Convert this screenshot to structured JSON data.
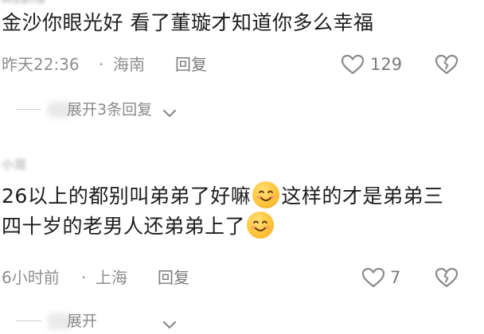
{
  "comments": [
    {
      "text": "金沙你眼光好  看了董璇才知道你多么幸福",
      "time": "昨天22:36",
      "separator": "·",
      "location": "海南",
      "reply_label": "回复",
      "like_count": "129",
      "expand_label": "展开3条回复"
    },
    {
      "text_part1": "26以上的都别叫弟弟了好嘛",
      "text_part2": "这样的才是弟弟三四十岁的老男人还弟弟上了",
      "time": "6小时前",
      "separator": "·",
      "location": "上海",
      "reply_label": "回复",
      "like_count": "7",
      "expand_label": "展开"
    }
  ],
  "icons": {
    "like": "heart-outline-icon",
    "dislike": "broken-heart-icon",
    "expand": "chevron-down-icon",
    "emoji": "smiling-face-emoji"
  },
  "colors": {
    "text": "#1d1d1d",
    "meta": "#8e8e8e",
    "emoji": "#ffc43a"
  }
}
